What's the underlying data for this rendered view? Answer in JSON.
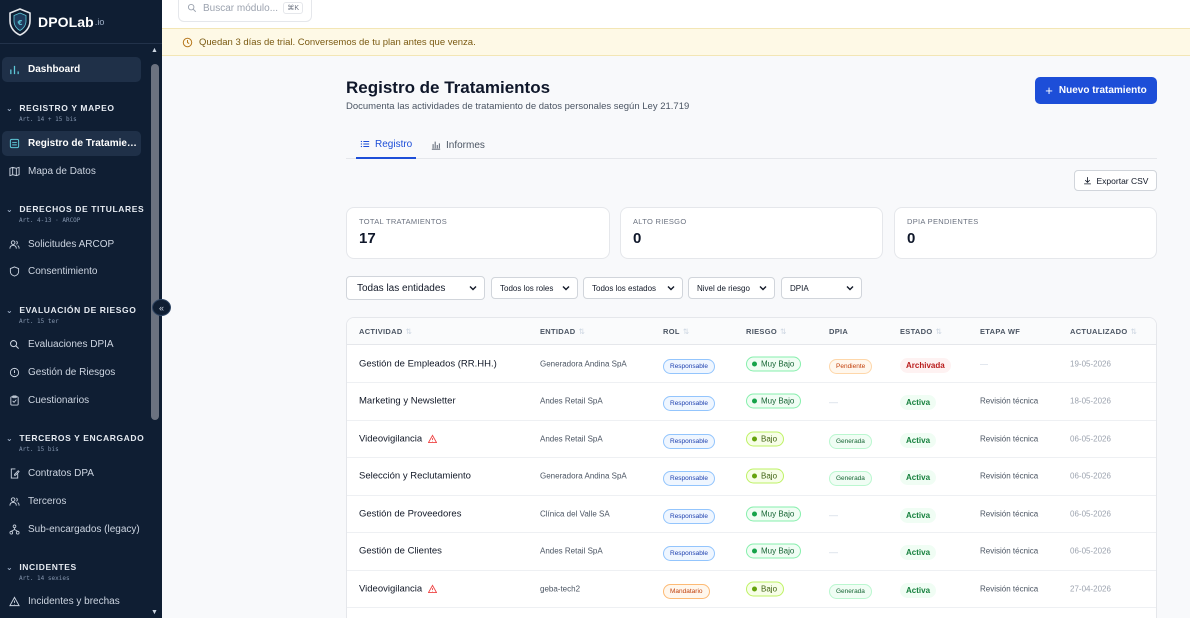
{
  "brand": {
    "name": "DPOLab",
    "tld": ".io"
  },
  "colors": {
    "sidebar_bg": "#0f1e33",
    "accent": "#1d4ed8",
    "trial_bg": "#fef9e6"
  },
  "search": {
    "placeholder": "Buscar módulo...",
    "shortcut": "⌘K"
  },
  "trial_banner": "Quedan 3 días de trial. Conversemos de tu plan antes que venza.",
  "sidebar": {
    "dashboard": "Dashboard",
    "sections": [
      {
        "title": "REGISTRO Y MAPEO",
        "sub": "Art. 14 + 15 bis",
        "items": [
          "Registro de Tratamientos",
          "Mapa de Datos"
        ]
      },
      {
        "title": "DERECHOS DE TITULARES",
        "sub": "Art. 4-13 · ARCOP",
        "items": [
          "Solicitudes ARCOP",
          "Consentimiento"
        ]
      },
      {
        "title": "EVALUACIÓN DE RIESGO",
        "sub": "Art. 15 ter",
        "items": [
          "Evaluaciones DPIA",
          "Gestión de Riesgos",
          "Cuestionarios"
        ]
      },
      {
        "title": "TERCEROS Y ENCARGADOS",
        "sub": "Art. 15 bis",
        "items": [
          "Contratos DPA",
          "Terceros",
          "Sub-encargados (legacy)"
        ]
      },
      {
        "title": "INCIDENTES",
        "sub": "Art. 14 sexies",
        "items": [
          "Incidentes y brechas"
        ]
      }
    ]
  },
  "page": {
    "title": "Registro de Tratamientos",
    "subtitle": "Documenta las actividades de tratamiento de datos personales según Ley 21.719",
    "new_button": "Nuevo tratamiento",
    "tabs": [
      "Registro",
      "Informes"
    ],
    "export_button": "Exportar CSV"
  },
  "stats": [
    {
      "label": "TOTAL TRATAMIENTOS",
      "value": "17"
    },
    {
      "label": "ALTO RIESGO",
      "value": "0"
    },
    {
      "label": "DPIA PENDIENTES",
      "value": "0"
    }
  ],
  "filters": [
    "Todas las entidades",
    "Todos los roles",
    "Todos los estados",
    "Nivel de riesgo",
    "DPIA"
  ],
  "table": {
    "headers": [
      "ACTIVIDAD",
      "ENTIDAD",
      "ROL",
      "RIESGO",
      "DPIA",
      "ESTADO",
      "ETAPA WF",
      "ACTUALIZADO"
    ],
    "rows": [
      {
        "actividad": "Gestión de Empleados (RR.HH.)",
        "warn": false,
        "entidad": "Generadora Andina SpA",
        "rol": "Responsable",
        "riesgo": "Muy Bajo",
        "dpia": "Pendiente",
        "estado": "Archivada",
        "etapa": "—",
        "actualizado": "19-05-2026"
      },
      {
        "actividad": "Marketing y Newsletter",
        "warn": false,
        "entidad": "Andes Retail SpA",
        "rol": "Responsable",
        "riesgo": "Muy Bajo",
        "dpia": "—",
        "estado": "Activa",
        "etapa": "Revisión técnica",
        "actualizado": "18-05-2026"
      },
      {
        "actividad": "Videovigilancia",
        "warn": true,
        "entidad": "Andes Retail SpA",
        "rol": "Responsable",
        "riesgo": "Bajo",
        "dpia": "Generada",
        "estado": "Activa",
        "etapa": "Revisión técnica",
        "actualizado": "06-05-2026"
      },
      {
        "actividad": "Selección y Reclutamiento",
        "warn": false,
        "entidad": "Generadora Andina SpA",
        "rol": "Responsable",
        "riesgo": "Bajo",
        "dpia": "Generada",
        "estado": "Activa",
        "etapa": "Revisión técnica",
        "actualizado": "06-05-2026"
      },
      {
        "actividad": "Gestión de Proveedores",
        "warn": false,
        "entidad": "Clínica del Valle SA",
        "rol": "Responsable",
        "riesgo": "Muy Bajo",
        "dpia": "—",
        "estado": "Activa",
        "etapa": "Revisión técnica",
        "actualizado": "06-05-2026"
      },
      {
        "actividad": "Gestión de Clientes",
        "warn": false,
        "entidad": "Andes Retail SpA",
        "rol": "Responsable",
        "riesgo": "Muy Bajo",
        "dpia": "—",
        "estado": "Activa",
        "etapa": "Revisión técnica",
        "actualizado": "06-05-2026"
      },
      {
        "actividad": "Videovigilancia",
        "warn": true,
        "entidad": "geba-tech2",
        "rol": "Mandatario",
        "riesgo": "Bajo",
        "dpia": "Generada",
        "estado": "Activa",
        "etapa": "Revisión técnica",
        "actualizado": "27-04-2026"
      }
    ]
  }
}
